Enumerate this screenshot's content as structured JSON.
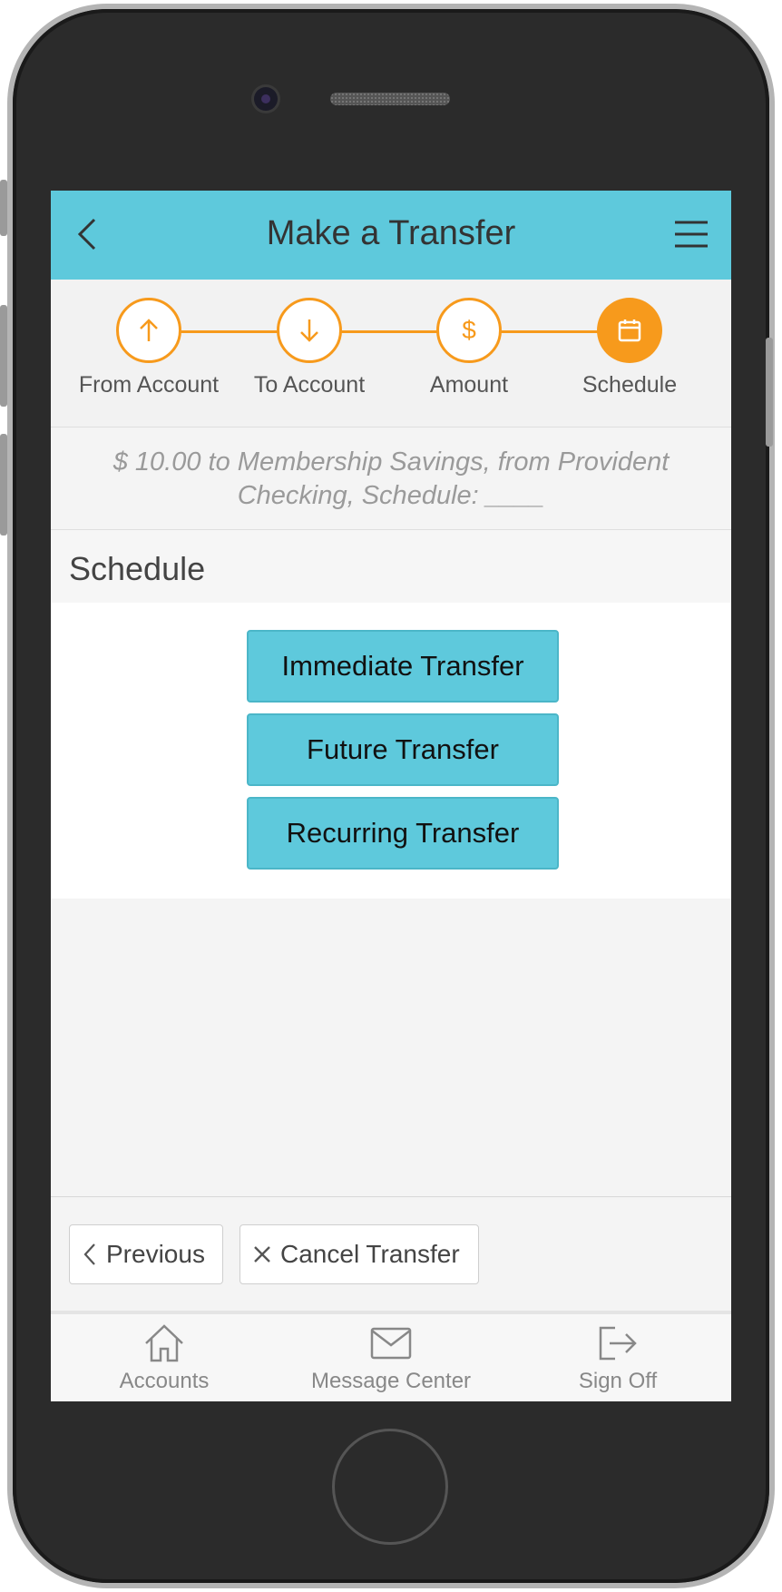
{
  "header": {
    "title": "Make a Transfer"
  },
  "steps": [
    {
      "label": "From Account",
      "icon": "arrow-up-icon",
      "active": false
    },
    {
      "label": "To Account",
      "icon": "arrow-down-icon",
      "active": false
    },
    {
      "label": "Amount",
      "icon": "dollar-icon",
      "active": false
    },
    {
      "label": "Schedule",
      "icon": "calendar-icon",
      "active": true
    }
  ],
  "summary": {
    "line1": "$ 10.00 to Membership Savings, from Provident",
    "line2": "Checking, Schedule: ____"
  },
  "schedule": {
    "heading": "Schedule",
    "options": [
      "Immediate Transfer",
      "Future Transfer",
      "Recurring Transfer"
    ]
  },
  "footer": {
    "previous_label": "Previous",
    "cancel_label": "Cancel Transfer"
  },
  "tabs": [
    {
      "label": "Accounts",
      "icon": "home-icon"
    },
    {
      "label": "Message Center",
      "icon": "mail-icon"
    },
    {
      "label": "Sign Off",
      "icon": "sign-off-icon"
    }
  ],
  "colors": {
    "accent": "#5ec9dc",
    "step": "#f79a1c"
  }
}
